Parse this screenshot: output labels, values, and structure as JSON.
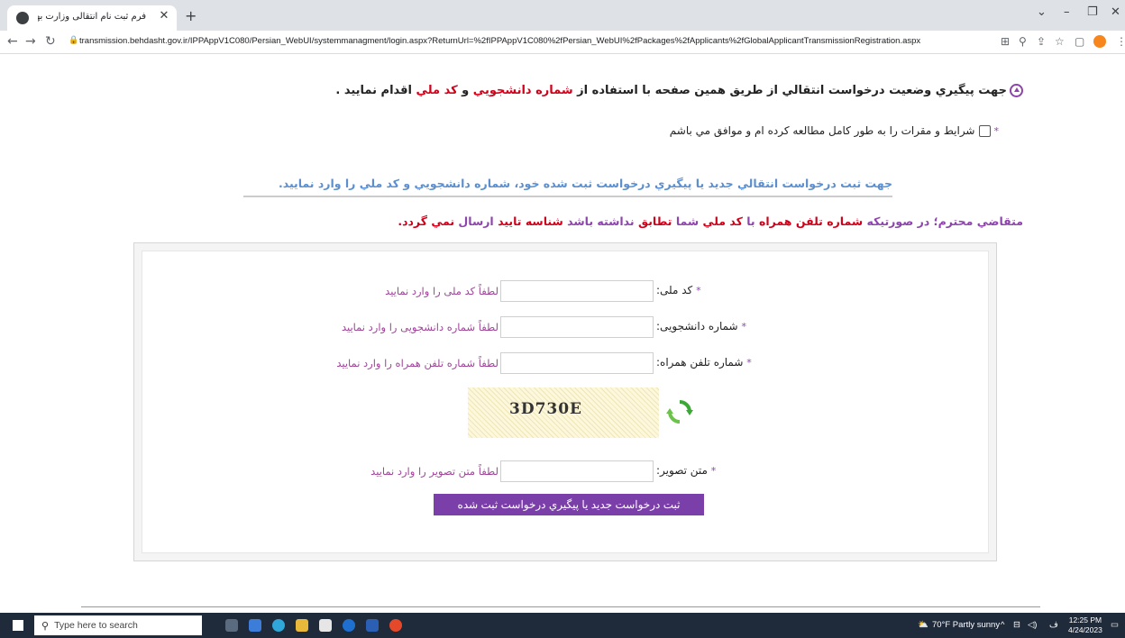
{
  "browser": {
    "tab_title": "فرم ثبت نام انتقالی وزارت بهداشت",
    "url": "transmission.behdasht.gov.ir/IPPAppV1C080/Persian_WebUI/systemmanagment/login.aspx?ReturnUrl=%2fIPPAppV1C080%2fPersian_WebUI%2fPackages%2fApplicants%2fGlobalApplicantTransmissionRegistration.aspx"
  },
  "page": {
    "notice": {
      "part1": "جهت پيگيري وضعيت درخواست انتقالي از طريق همين صفحه با استفاده از ",
      "student_no": "شماره دانشجويي",
      "and": " و ",
      "national_code": "كد ملي",
      "part2": " اقدام نماييد ."
    },
    "terms_label": "شرايط و مقرات را به طور كامل مطالعه كرده ام و موافق مي باشم",
    "instructions": "جهت ثبت درخواست انتقالي جديد يا پيگيري درخواست ثبت شده خود، شماره دانشجويي و كد ملي را وارد نماييد.",
    "warning": {
      "p1": "متقاضي محترم؛ در صورتيكه ",
      "phone": "شماره تلفن همراه",
      "p2": " با ",
      "nc": "كد ملي",
      "p3": " شما ",
      "match": "تطابق",
      "p4": " نداشته باشد ",
      "id": "شناسه تاييد",
      "p5": " ارسال ",
      "not": "نمي گردد."
    }
  },
  "form": {
    "national_code": {
      "label": "كد ملی:",
      "value": "",
      "hint": "لطفاً كد ملی را وارد نمایید"
    },
    "student_number": {
      "label": "شماره دانشجویی:",
      "value": "",
      "hint": "لطفاً شماره دانشجویی را وارد نمایید"
    },
    "mobile": {
      "label": "شماره تلفن همراه:",
      "value": "",
      "hint": "لطفاً شماره تلفن همراه را وارد نمایید"
    },
    "captcha_text": "3D730E",
    "captcha_input": {
      "label": "متن تصویر:",
      "value": "",
      "hint": "لطفاً متن تصویر را وارد نمایید"
    },
    "required_mark": "*",
    "submit_label": "ثبت درخواست جديد يا پيگيري درخواست ثبت شده"
  },
  "taskbar": {
    "search_placeholder": "Type here to search",
    "weather": "70°F Partly sunny",
    "time": "12:25 PM",
    "date": "4/24/2023"
  },
  "colors": {
    "accent_purple": "#7a3fa8",
    "red": "#d0021b",
    "blue_text": "#5b8fd0"
  }
}
